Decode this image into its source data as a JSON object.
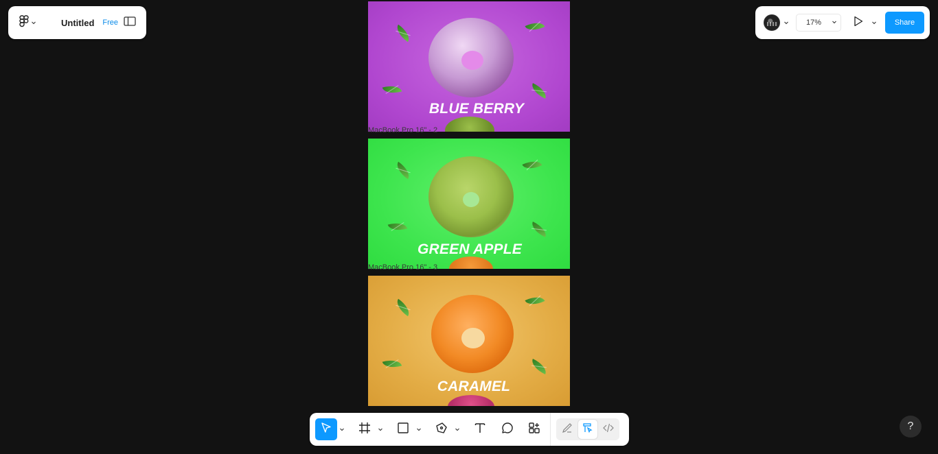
{
  "file": {
    "title": "Untitled",
    "plan": "Free"
  },
  "zoom": {
    "value": "17%"
  },
  "share": {
    "label": "Share"
  },
  "frames": [
    {
      "title": "BLUE BERRY",
      "label": ""
    },
    {
      "title": "GREEN APPLE",
      "label": "MacBook Pro 16\" - 2"
    },
    {
      "title": "CARAMEL",
      "label": "MacBook Pro 16\" - 3"
    }
  ],
  "help": {
    "label": "?"
  },
  "colors": {
    "accent": "#0d99ff",
    "canvas": "#121212",
    "blueberry_bg": "#b452d2",
    "greenapple_bg": "#3ee54e",
    "caramel_bg": "#e0a840"
  },
  "toolbar": {
    "tools": [
      "move-icon",
      "frame-icon",
      "rectangle-icon",
      "pen-icon",
      "text-icon",
      "comment-icon",
      "actions-icon"
    ],
    "modes": [
      "draw-mode-icon",
      "design-mode-icon",
      "dev-mode-icon"
    ]
  }
}
